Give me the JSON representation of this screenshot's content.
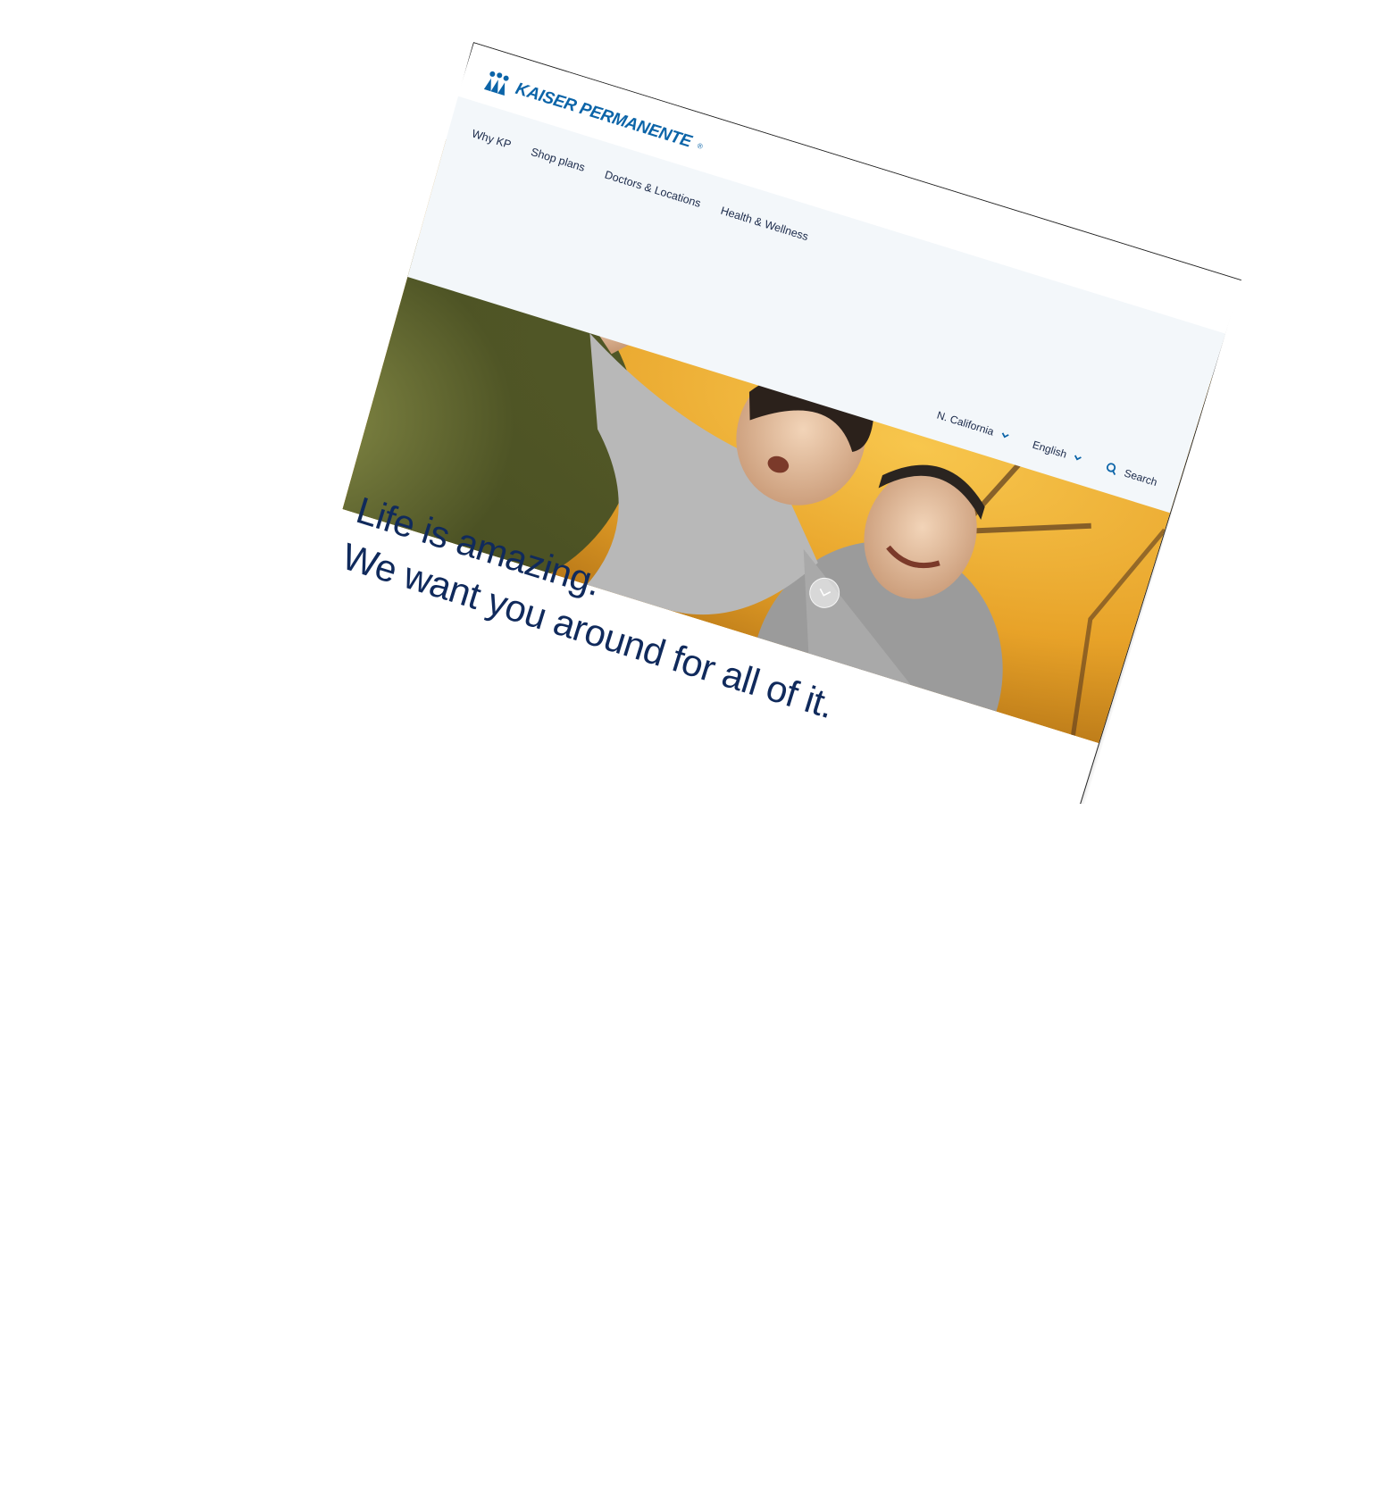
{
  "brand": {
    "name": "KAISER PERMANENTE",
    "registered_mark": "®",
    "color": "#0b64a8"
  },
  "nav": {
    "items": [
      {
        "label": "Why KP"
      },
      {
        "label": "Shop plans"
      },
      {
        "label": "Doctors & Locations"
      },
      {
        "label": "Health & Wellness"
      }
    ]
  },
  "utility": {
    "region": {
      "label": "N. California",
      "icon": "chevron-down-icon"
    },
    "language": {
      "label": "English",
      "icon": "chevron-down-icon"
    },
    "search": {
      "label": "Search",
      "icon": "search-icon"
    }
  },
  "hero": {
    "headline_line1": "Life is amazing.",
    "headline_line2": "We want you around for all of it.",
    "text_color": "#102a5c",
    "scroll_icon": "chevron-down-icon"
  }
}
